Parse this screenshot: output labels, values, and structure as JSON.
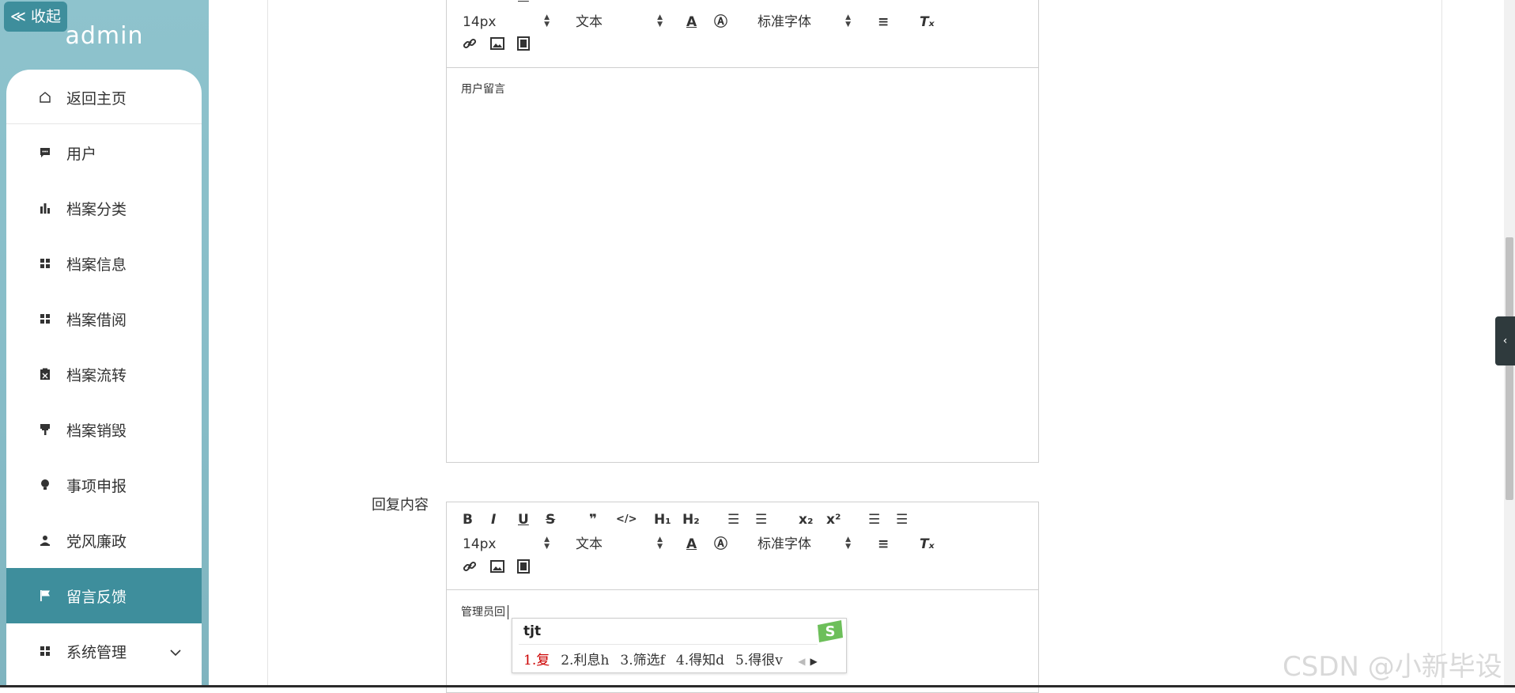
{
  "sidebar": {
    "collapse_label": "≪ 收起",
    "username": "admin",
    "items": [
      {
        "label": "返回主页",
        "icon": "home-icon"
      },
      {
        "label": "用户",
        "icon": "message-icon"
      },
      {
        "label": "档案分类",
        "icon": "bar-chart-icon"
      },
      {
        "label": "档案信息",
        "icon": "grid-icon"
      },
      {
        "label": "档案借阅",
        "icon": "grid-icon"
      },
      {
        "label": "档案流转",
        "icon": "clipboard-icon"
      },
      {
        "label": "档案销毁",
        "icon": "brush-icon"
      },
      {
        "label": "事项申报",
        "icon": "bulb-icon"
      },
      {
        "label": "党风廉政",
        "icon": "user-icon"
      },
      {
        "label": "留言反馈",
        "icon": "flag-icon",
        "active": true
      },
      {
        "label": "系统管理",
        "icon": "grid-icon"
      }
    ]
  },
  "editor_top": {
    "font_size": "14px",
    "block_type": "文本",
    "font_family": "标准字体",
    "content": "用户留言"
  },
  "reply": {
    "label": "回复内容",
    "toolbar": {
      "font_size": "14px",
      "block_type": "文本",
      "font_family": "标准字体"
    },
    "content": "管理员回"
  },
  "ime": {
    "input": "tjt",
    "candidates": [
      "1.复",
      "2.利息h",
      "3.筛选f",
      "4.得知d",
      "5.得很v"
    ]
  },
  "watermark": "CSDN @小新毕设"
}
